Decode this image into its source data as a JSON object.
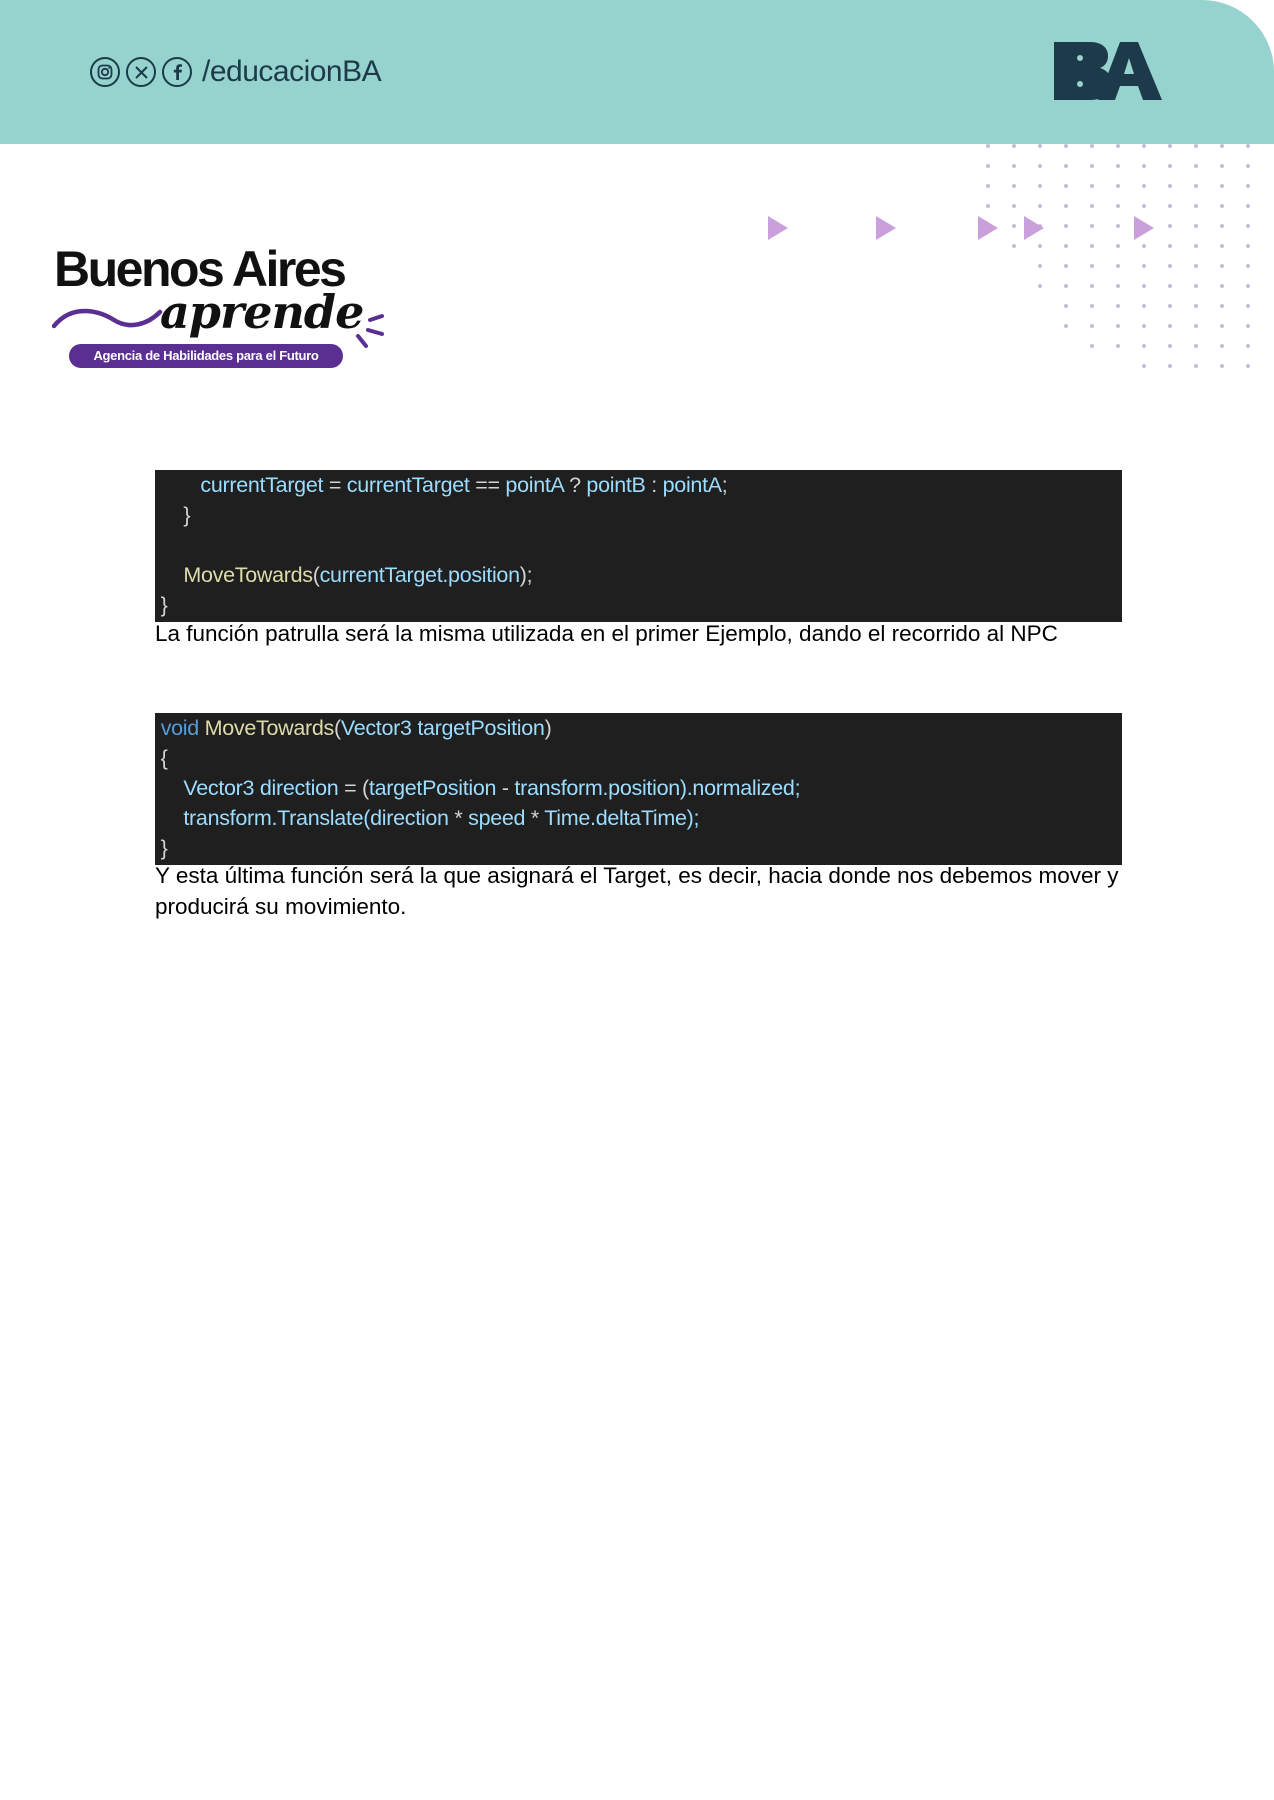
{
  "header": {
    "social_icons": [
      "instagram-icon",
      "x-icon",
      "facebook-icon"
    ],
    "handle": "/educacionBA",
    "logo_text": "BA",
    "band_color": "#96d3ce",
    "logo_color": "#1c3a4a"
  },
  "brand": {
    "title": "Buenos Aires",
    "script": "aprende",
    "tagline": "Agencia de Habilidades para el Futuro",
    "accent_color": "#5a2f91"
  },
  "decor": {
    "arrow_color": "#c9a0dc",
    "dot_color": "#c6bcd8"
  },
  "code_blocks": [
    {
      "lines": [
        [
          {
            "t": "        ",
            "c": "w"
          },
          {
            "t": "currentTarget",
            "c": "b"
          },
          {
            "t": " = ",
            "c": "w"
          },
          {
            "t": "currentTarget",
            "c": "b"
          },
          {
            "t": " == ",
            "c": "w"
          },
          {
            "t": "pointA",
            "c": "b"
          },
          {
            "t": " ? ",
            "c": "w"
          },
          {
            "t": "pointB",
            "c": "b"
          },
          {
            "t": " : ",
            "c": "w"
          },
          {
            "t": "pointA",
            "c": "b"
          },
          {
            "t": ";",
            "c": "w"
          }
        ],
        [
          {
            "t": "     }",
            "c": "w"
          }
        ],
        [
          {
            "t": "",
            "c": "w"
          }
        ],
        [
          {
            "t": "     ",
            "c": "w"
          },
          {
            "t": "MoveTowards",
            "c": "y"
          },
          {
            "t": "(",
            "c": "w"
          },
          {
            "t": "currentTarget.position",
            "c": "b"
          },
          {
            "t": ");",
            "c": "w"
          }
        ],
        [
          {
            "t": " }",
            "c": "w"
          }
        ]
      ]
    },
    {
      "lines": [
        [
          {
            "t": " ",
            "c": "w"
          },
          {
            "t": "void",
            "c": "k"
          },
          {
            "t": " ",
            "c": "w"
          },
          {
            "t": "MoveTowards",
            "c": "y"
          },
          {
            "t": "(",
            "c": "w"
          },
          {
            "t": "Vector3 targetPosition",
            "c": "b"
          },
          {
            "t": ")",
            "c": "w"
          }
        ],
        [
          {
            "t": " {",
            "c": "w"
          }
        ],
        [
          {
            "t": "     ",
            "c": "w"
          },
          {
            "t": "Vector3 direction",
            "c": "b"
          },
          {
            "t": " = (",
            "c": "w"
          },
          {
            "t": "targetPosition",
            "c": "b"
          },
          {
            "t": " - ",
            "c": "w"
          },
          {
            "t": "transform.position).normalized;",
            "c": "b"
          }
        ],
        [
          {
            "t": "     ",
            "c": "w"
          },
          {
            "t": "transform.Translate(direction",
            "c": "b"
          },
          {
            "t": " * ",
            "c": "w"
          },
          {
            "t": "speed",
            "c": "b"
          },
          {
            "t": " * ",
            "c": "w"
          },
          {
            "t": "Time.deltaTime);",
            "c": "b"
          }
        ],
        [
          {
            "t": " }",
            "c": "w"
          }
        ]
      ]
    }
  ],
  "paragraphs": [
    "La función patrulla será la misma utilizada en el primer Ejemplo, dando el recorrido al NPC",
    "Y esta última función será la que asignará el Target, es decir, hacia donde nos debemos mover y producirá su movimiento."
  ]
}
